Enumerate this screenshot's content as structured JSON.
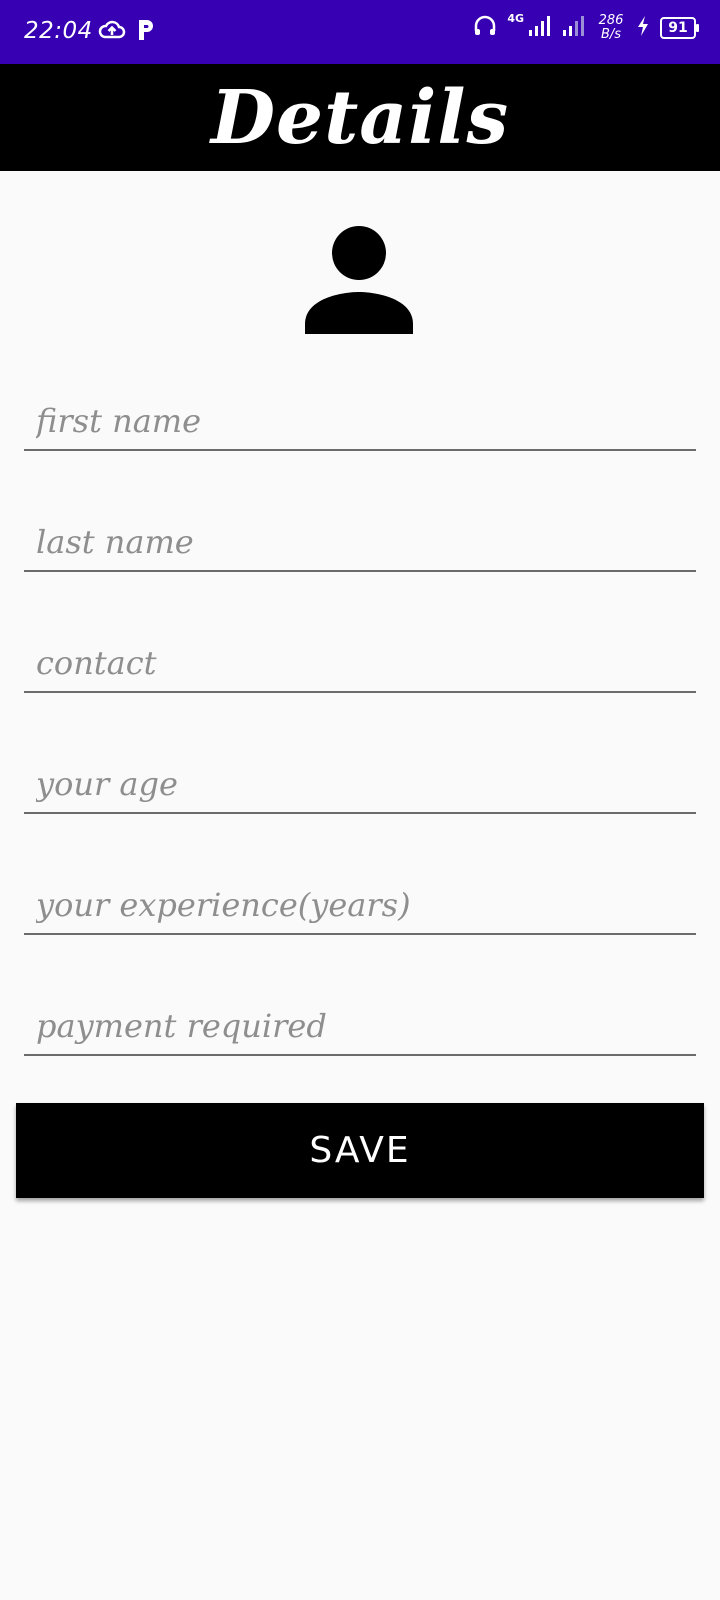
{
  "status_bar": {
    "time": "22:04",
    "network_type": "4G",
    "speed_value": "286",
    "speed_unit": "B/s",
    "battery_level": "91",
    "icons": [
      "cloud-upload-icon",
      "p-app-icon",
      "headset-icon",
      "signal-icon",
      "signal-icon",
      "charging-bolt-icon",
      "battery-icon"
    ]
  },
  "toolbar": {
    "title": "Details"
  },
  "form": {
    "avatar_icon": "person-icon",
    "fields": [
      {
        "placeholder": "first name",
        "value": ""
      },
      {
        "placeholder": "last name",
        "value": ""
      },
      {
        "placeholder": "contact",
        "value": ""
      },
      {
        "placeholder": "your age",
        "value": ""
      },
      {
        "placeholder": "your experience(years)",
        "value": ""
      },
      {
        "placeholder": "payment required",
        "value": ""
      }
    ],
    "save_label": "SAVE"
  },
  "colors": {
    "status_bar_bg": "#3700b3",
    "toolbar_bg": "#000000",
    "page_bg": "#fafafa",
    "button_bg": "#000000",
    "button_text": "#ffffff"
  }
}
